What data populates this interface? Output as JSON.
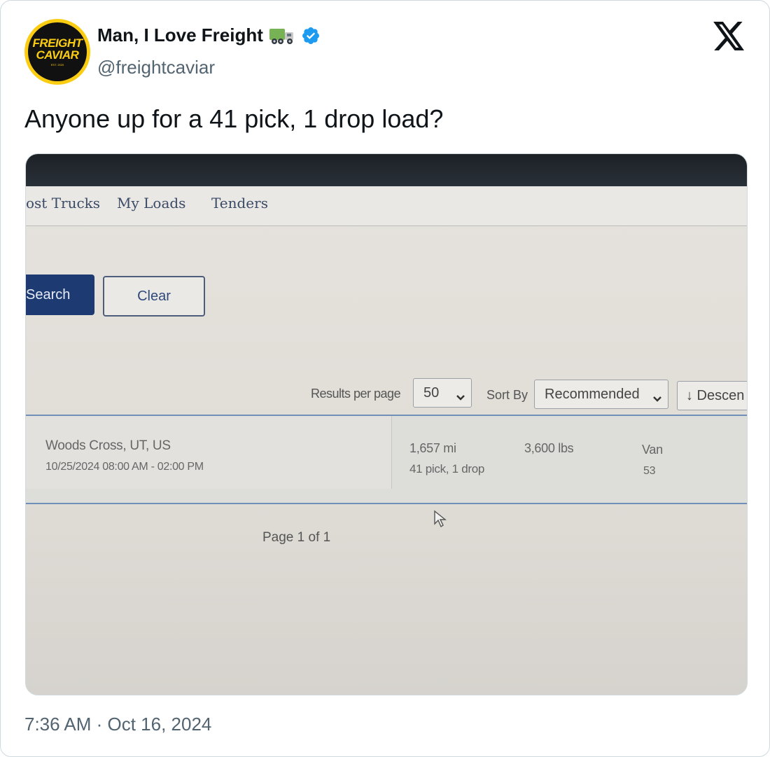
{
  "author": {
    "avatar_text": [
      "FREIGHT",
      "CAVIAR"
    ],
    "avatar_small_text": "EST. 2020",
    "display_name": "Man, I Love Freight",
    "handle": "@freightcaviar",
    "name_icons": [
      "delivery-truck-emoji-icon",
      "verified-badge-icon"
    ]
  },
  "platform_icon": "x-logo-icon",
  "tweet_text": "Anyone up for a 41 pick, 1 drop load?",
  "photo": {
    "nav_tabs": [
      "ost Trucks",
      "My Loads",
      "Tenders"
    ],
    "buttons": {
      "search": "Search",
      "clear": "Clear"
    },
    "results_per_page_label": "Results per page",
    "results_per_page_value": "50",
    "sort_by_label": "Sort By",
    "sort_by_value": "Recommended",
    "sort_direction": "↓ Descen",
    "result": {
      "location": "Woods Cross, UT, US",
      "datetime": "10/25/2024  08:00 AM - 02:00 PM",
      "distance": "1,657 mi",
      "stops": "41 pick, 1 drop",
      "weight": "3,600 lbs",
      "equipment": "Van",
      "length": "53"
    },
    "pagination": "Page 1 of 1"
  },
  "timestamp": "7:36 AM · Oct 16, 2024",
  "colors": {
    "avatar_yellow": "#facd12",
    "verified_blue": "#1d9bf0",
    "search_button": "#1e3a73",
    "secondary_text": "#536471"
  }
}
